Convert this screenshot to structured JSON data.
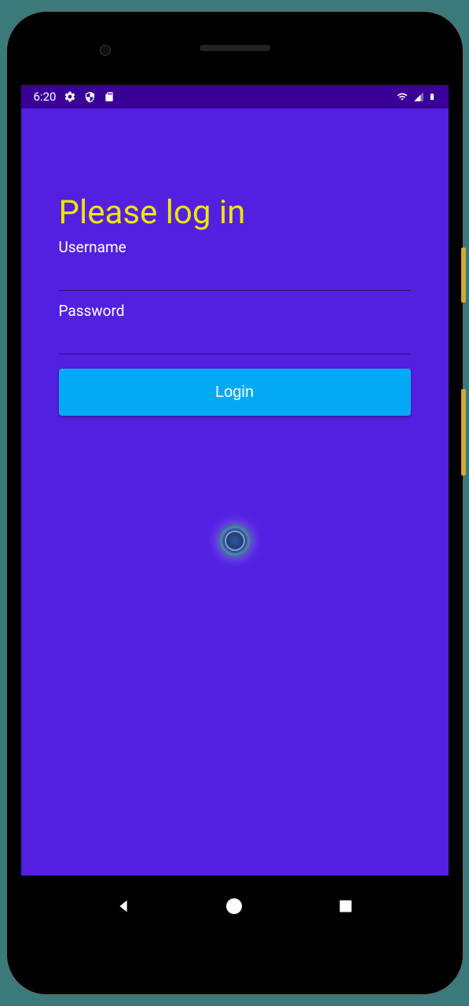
{
  "statusBar": {
    "time": "6:20"
  },
  "login": {
    "title": "Please log in",
    "usernameLabel": "Username",
    "passwordLabel": "Password",
    "buttonLabel": "Login"
  }
}
